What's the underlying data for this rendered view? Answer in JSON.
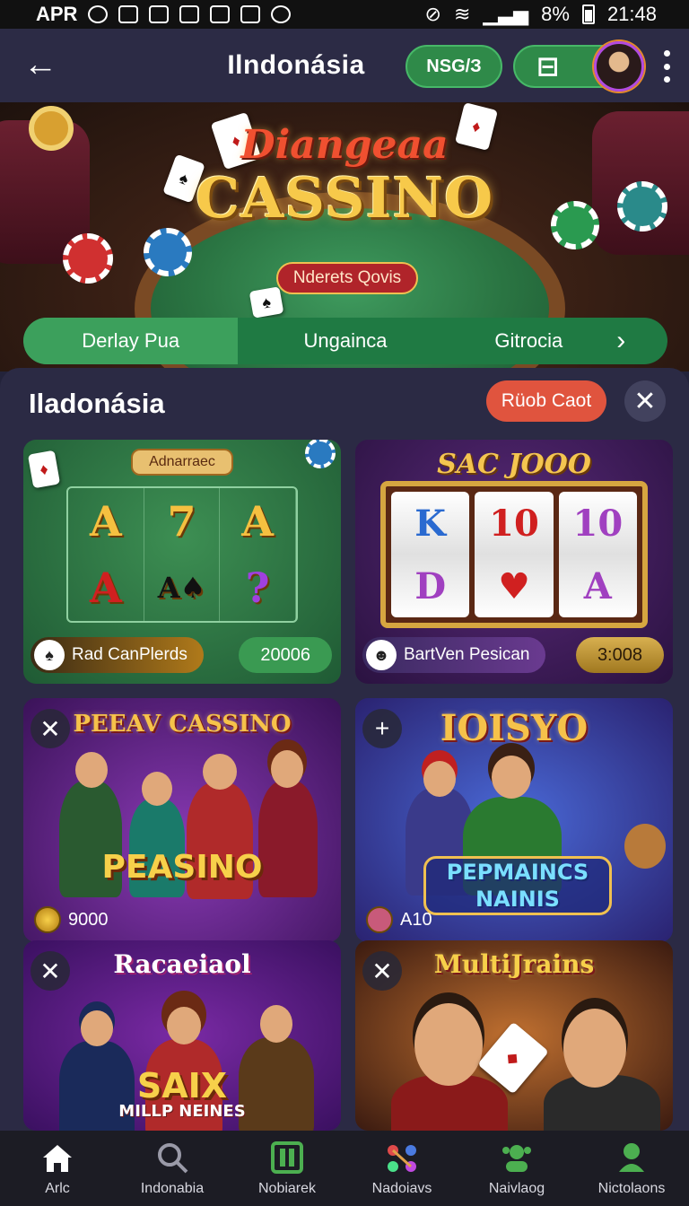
{
  "status_bar": {
    "carrier": "APR",
    "battery_percent": "8%",
    "time": "21:48",
    "icons": [
      "signal-off-icon",
      "wifi-icon",
      "cell-signal-icon",
      "battery-icon"
    ]
  },
  "header": {
    "title": "Ilndonásia",
    "msg_pill": "NSG/З",
    "wallet_icon": "wallet-icon"
  },
  "hero": {
    "logo_top": "Diangeaa",
    "logo_main": "CASSINO",
    "badge": "Nderets Qovis"
  },
  "tabs": [
    {
      "label": "Derlay Pua",
      "active": true
    },
    {
      "label": "Ungainca",
      "active": false
    },
    {
      "label": "Gitrocia",
      "active": false
    }
  ],
  "section": {
    "title": "Iladonásia",
    "filter_label": "Rüob Caot"
  },
  "games": [
    {
      "header": "Adnarraec",
      "symbols": [
        "A",
        "7",
        "A",
        "A",
        "A♠",
        "?"
      ],
      "label": "Rad CanPlerds",
      "value": "20006"
    },
    {
      "header": "SAC JOOO",
      "reel1": [
        "K",
        "D"
      ],
      "reel2": [
        "10",
        "♥"
      ],
      "reel3": [
        "10",
        "A"
      ],
      "label": "BartVen Pesican",
      "value": "3:008"
    },
    {
      "top_title": "PEEAV CASSINO",
      "big_title": "PEASINO",
      "stat": "9000"
    },
    {
      "top_title": "IOISYO",
      "big_title": "PEPMAINCS NAINIS",
      "stat": "A10"
    },
    {
      "top_title": "Racaeiaol",
      "big_title": "SAIX",
      "sub_title": "MILLP NEINES"
    },
    {
      "top_title": "MultiJrains"
    }
  ],
  "bottom_nav": [
    {
      "label": "Arlc",
      "icon": "home-icon",
      "color": "#ffffff"
    },
    {
      "label": "Indonabia",
      "icon": "search-icon",
      "color": "#9a9aa8"
    },
    {
      "label": "Nobiarek",
      "icon": "slots-icon",
      "color": "#4caf50"
    },
    {
      "label": "Nadoiavs",
      "icon": "network-icon",
      "color": "#e04a7a"
    },
    {
      "label": "Naivlaog",
      "icon": "people-icon",
      "color": "#4caf50"
    },
    {
      "label": "Nictolaons",
      "icon": "profile-icon",
      "color": "#4caf50"
    }
  ]
}
